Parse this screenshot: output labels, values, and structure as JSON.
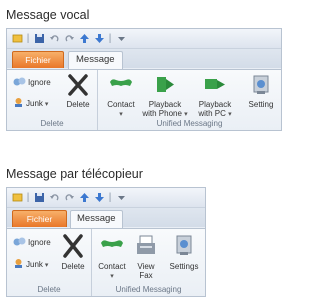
{
  "sections": [
    {
      "title": "Message vocal",
      "tabs": {
        "file": "Fichier",
        "message": "Message"
      },
      "delete_group": {
        "label": "Delete",
        "ignore": "Ignore",
        "junk": "Junk",
        "junk_arrow": "▾",
        "delete": "Delete"
      },
      "um_group": {
        "label": "Unified Messaging",
        "contact": "Contact",
        "contact_arrow": "▾",
        "phone_line1": "Playback",
        "phone_line2": "with Phone",
        "phone_arrow": "▾",
        "pc_line1": "Playback",
        "pc_line2": "with PC",
        "pc_arrow": "▾",
        "settings": "Setting"
      }
    },
    {
      "title": "Message par télécopieur",
      "tabs": {
        "file": "Fichier",
        "message": "Message"
      },
      "delete_group": {
        "label": "Delete",
        "ignore": "Ignore",
        "junk": "Junk",
        "junk_arrow": "▾",
        "delete": "Delete"
      },
      "um_group": {
        "label": "Unified Messaging",
        "contact": "Contact",
        "contact_arrow": "▾",
        "fax_line1": "View",
        "fax_line2": "Fax",
        "settings": "Settings"
      }
    }
  ],
  "colors": {
    "accent_file_tab": "#e9772a",
    "ribbon_bg": "#e9eef5",
    "icon_green": "#3aa14a"
  },
  "icons": [
    "save-icon",
    "undo-icon",
    "redo-icon",
    "up-arrow-icon",
    "down-arrow-icon",
    "customize-icon",
    "ignore-icon",
    "junk-icon",
    "delete-x-icon",
    "contact-phone-icon",
    "playback-phone-icon",
    "playback-pc-icon",
    "settings-icon",
    "view-fax-icon"
  ]
}
